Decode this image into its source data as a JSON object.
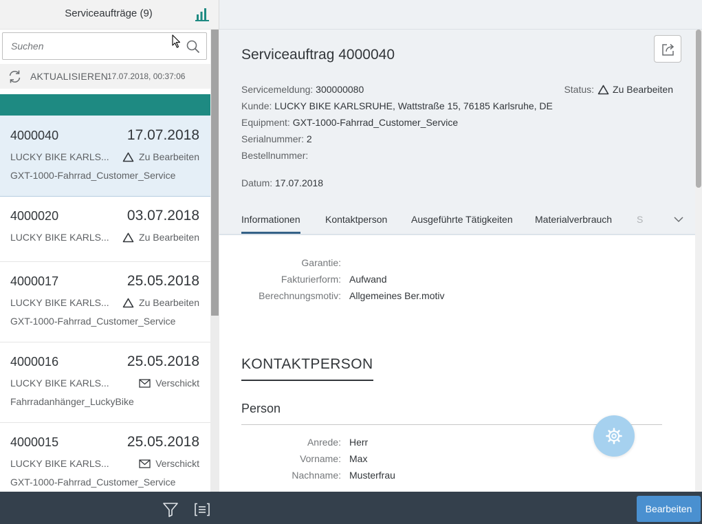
{
  "master": {
    "title": "Serviceaufträge (9)",
    "search": {
      "placeholder": "Suchen",
      "value": ""
    },
    "refresh": {
      "label": "AKTUALISIEREN",
      "timestamp": "17.07.2018, 00:37:06"
    },
    "items": [
      {
        "id": "4000040",
        "date": "17.07.2018",
        "customer": "LUCKY BIKE KARLS...",
        "status": "Zu Bearbeiten",
        "status_icon": "warning-triangle-icon",
        "equipment": "GXT-1000-Fahrrad_Customer_Service",
        "selected": true
      },
      {
        "id": "4000020",
        "date": "03.07.2018",
        "customer": "LUCKY BIKE KARLS...",
        "status": "Zu Bearbeiten",
        "status_icon": "warning-triangle-icon",
        "equipment": ""
      },
      {
        "id": "4000017",
        "date": "25.05.2018",
        "customer": "LUCKY BIKE KARLS...",
        "status": "Zu Bearbeiten",
        "status_icon": "warning-triangle-icon",
        "equipment": "GXT-1000-Fahrrad_Customer_Service"
      },
      {
        "id": "4000016",
        "date": "25.05.2018",
        "customer": "LUCKY BIKE KARLS...",
        "status": "Verschickt",
        "status_icon": "envelope-icon",
        "equipment": "Fahrradanhänger_LuckyBike"
      },
      {
        "id": "4000015",
        "date": "25.05.2018",
        "customer": "LUCKY BIKE KARLS...",
        "status": "Verschickt",
        "status_icon": "envelope-icon",
        "equipment": "GXT-1000-Fahrrad_Customer_Service"
      }
    ]
  },
  "detail": {
    "title": "Serviceauftrag 4000040",
    "attributes": {
      "servicemeldung": {
        "label": "Servicemeldung:",
        "value": "300000080"
      },
      "kunde": {
        "label": "Kunde:",
        "value": "LUCKY BIKE KARLSRUHE, Wattstraße 15, 76185 Karlsruhe, DE"
      },
      "equipment": {
        "label": "Equipment:",
        "value": "GXT-1000-Fahrrad_Customer_Service"
      },
      "serialnummer": {
        "label": "Serialnummer:",
        "value": "2"
      },
      "bestellnummer": {
        "label": "Bestellnummer:",
        "value": ""
      },
      "datum": {
        "label": "Datum:",
        "value": "17.07.2018"
      }
    },
    "status": {
      "label": "Status:",
      "value": "Zu Bearbeiten"
    },
    "tabs": [
      "Informationen",
      "Kontaktperson",
      "Ausgeführte Tätigkeiten",
      "Materialverbrauch",
      "S"
    ],
    "info_fields": [
      {
        "label": "Garantie:",
        "value": ""
      },
      {
        "label": "Fakturierform:",
        "value": "Aufwand"
      },
      {
        "label": "Berechnungsmotiv:",
        "value": "Allgemeines Ber.motiv"
      }
    ],
    "contact_section": {
      "title": "KONTAKTPERSON",
      "subtitle": "Person",
      "fields": [
        {
          "label": "Anrede:",
          "value": "Herr"
        },
        {
          "label": "Vorname:",
          "value": "Max"
        },
        {
          "label": "Nachname:",
          "value": "Musterfrau"
        }
      ]
    }
  },
  "footer": {
    "edit_label": "Bearbeiten"
  },
  "colors": {
    "accent": "#1e8a82",
    "selected_bg": "#e5eff7",
    "shell": "#34404c",
    "emphasized_button": "#4a90d0",
    "fab": "#a6d1ef"
  }
}
